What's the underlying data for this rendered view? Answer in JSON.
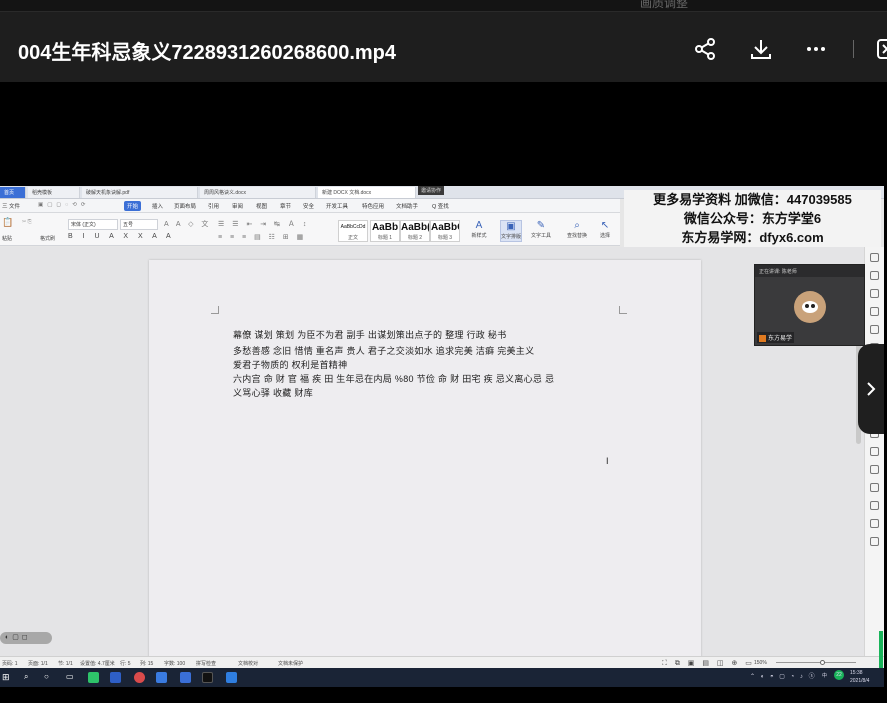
{
  "top_strip": {
    "ghost_text": "画质调整"
  },
  "header": {
    "title": "004生年科忌象义7228931260268600.mp4",
    "icons": [
      "share-icon",
      "download-icon",
      "more-icon",
      "sidebar-toggle-icon"
    ]
  },
  "wps": {
    "tabs": [
      "首页",
      "稻壳模板",
      "破解天机象诀解.pdf",
      "周周风格诀义.docx",
      "新建 DOCX 文档.docx"
    ],
    "tab_badge": "邀请协作",
    "menus": [
      "三 文件",
      "开始",
      "插入",
      "页面布局",
      "引用",
      "审阅",
      "视图",
      "章节",
      "安全",
      "开发工具",
      "特色应用",
      "文档助手",
      "Q 查找"
    ],
    "active_menu": "开始",
    "font_name": "宋体 (正文)",
    "font_size": "五号",
    "format_painter": "格式刷",
    "paste_label": "粘贴",
    "styles": [
      {
        "sample": "AaBbCcDd",
        "label": "正文"
      },
      {
        "sample": "AaBb",
        "label": "标题 1"
      },
      {
        "sample": "AaBb(",
        "label": "标题 2"
      },
      {
        "sample": "AaBbC(",
        "label": "标题 3"
      }
    ],
    "tools": [
      {
        "label": "新样式"
      },
      {
        "label": "文字排版"
      },
      {
        "label": "文字工具"
      },
      {
        "label": "查找替换"
      },
      {
        "label": "选择"
      }
    ]
  },
  "watermark": {
    "line1": "更多易学资料 加微信：447039585",
    "line2": "微信公众号：东方学堂6",
    "line3": "东方易学网：dfyx6.com"
  },
  "document": {
    "lines": [
      "幕僚  谋划  策划  为臣不为君  副手  出谋划策出点子的  整理  行政  秘书",
      "多愁善感  念旧  惜情  重名声  贵人  君子之交淡如水  追求完美  洁癖  完美主义",
      "爱君子物质的  权利是首精神",
      "六内宫  命 财 官 福  疾 田  生年忌在内局 %80 节俭  命 财 田宅 疾  忌义离心忌 忌",
      "义骂心驿  收藏  财库"
    ],
    "cursor_glyph": "I"
  },
  "webcam": {
    "header": "正在讲课: 陈老师",
    "name": "东方易学",
    "dots": "......"
  },
  "statusbar": {
    "page": "页码: 1",
    "pages": "页面: 1/1",
    "section": "节: 1/1",
    "position": "设置值: 4.7厘米",
    "line": "行: 5",
    "col": "列: 15",
    "words": "字数: 100",
    "spell": "拼写检查",
    "proof": "文档校对",
    "protect": "文档未保护",
    "zoom": "150%"
  },
  "taskbar": {
    "clock_time": "15:38",
    "clock_date": "2021/8/4",
    "lang": "中",
    "badge": "22"
  },
  "colors": {
    "accent": "#3b6fd6",
    "header_bg": "#1e1e1e",
    "taskbar_bg": "#1a2436",
    "green": "#19b45a"
  }
}
